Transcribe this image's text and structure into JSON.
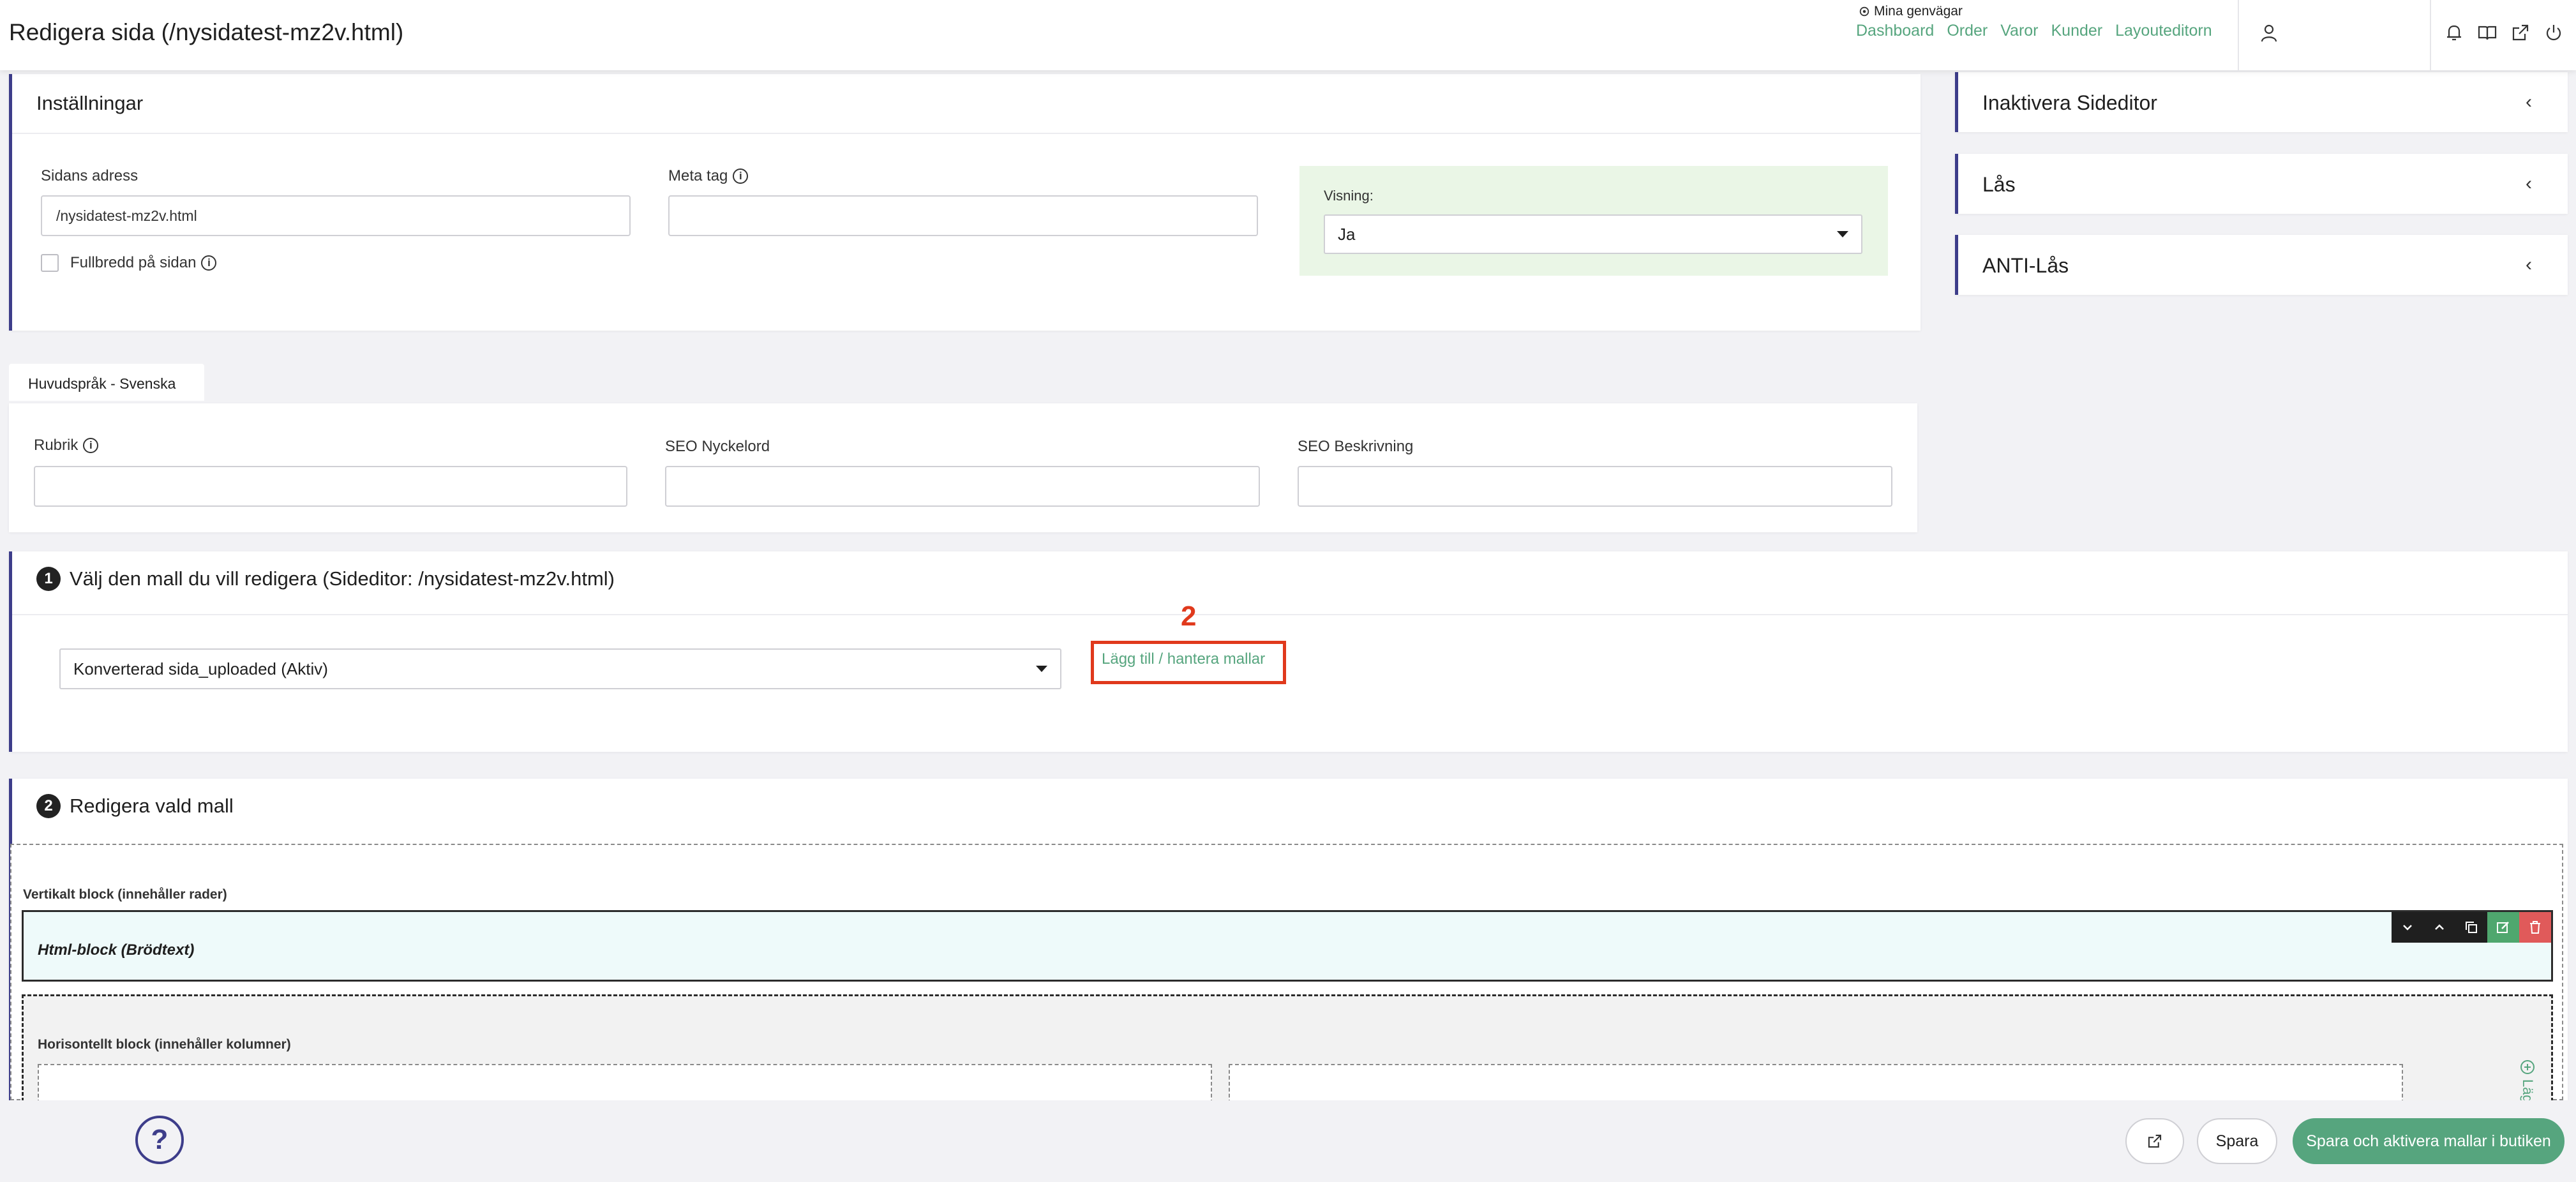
{
  "header": {
    "title": "Redigera sida (/nysidatest-mz2v.html)",
    "shortcuts_title": "Mina genvägar",
    "shortcuts": [
      "Dashboard",
      "Order",
      "Varor",
      "Kunder",
      "Layouteditorn"
    ]
  },
  "settings": {
    "title": "Inställningar",
    "address_label": "Sidans adress",
    "address_value": "/nysidatest-mz2v.html",
    "meta_label": "Meta tag",
    "meta_value": "",
    "fullwidth_label": "Fullbredd på sidan",
    "visning_label": "Visning:",
    "visning_value": "Ja"
  },
  "language": {
    "tab": "Huvudspråk - Svenska",
    "rubrik_label": "Rubrik",
    "seo_keywords_label": "SEO Nyckelord",
    "seo_desc_label": "SEO Beskrivning"
  },
  "sidebar": {
    "cards": [
      "Inaktivera Sideditor",
      "Lås",
      "ANTI-Lås"
    ]
  },
  "template_select": {
    "step": "1",
    "title": "Välj den mall du vill redigera (Sideditor: /nysidatest-mz2v.html)",
    "selected": "Konverterad sida_uploaded (Aktiv)",
    "manage_link": "Lägg till / hantera mallar",
    "annotation_number": "2"
  },
  "edit_template": {
    "step": "2",
    "title": "Redigera vald mall",
    "vertical_block_label": "Vertikalt block (innehåller rader)",
    "html_block_label": "Html-block (Brödtext)",
    "horizontal_block_label": "Horisontellt block (innehåller kolumner)",
    "add_column_label": "Läg"
  },
  "footer": {
    "help": "?",
    "save": "Spara",
    "save_activate": "Spara och aktivera mallar i butiken"
  },
  "colors": {
    "accent": "#3d3d8a",
    "link_green": "#56a57e",
    "highlight_red": "#e0391c",
    "visning_bg": "#eaf6e6",
    "html_block_bg": "#eefafa"
  }
}
